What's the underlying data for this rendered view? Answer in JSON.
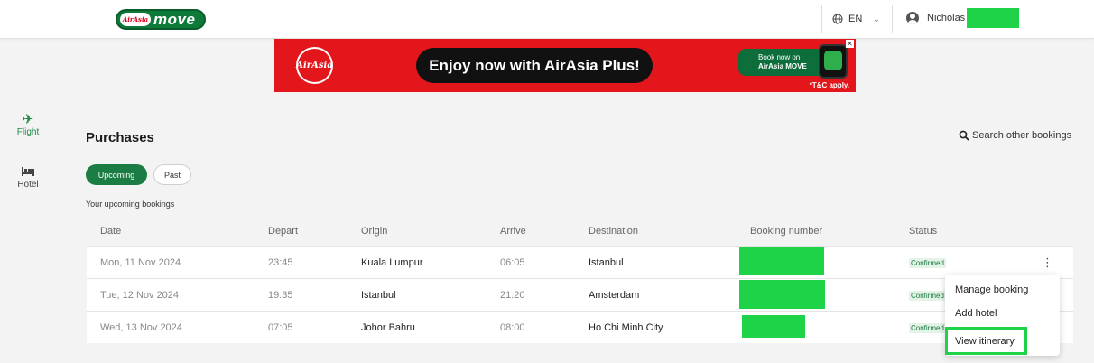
{
  "header": {
    "logo": {
      "badge": "AirAsia",
      "word": "move"
    },
    "language": "EN",
    "user_name": "Nicholas"
  },
  "banner": {
    "brand": "AirAsia",
    "headline": "Enjoy now with AirAsia Plus!",
    "cta_line1": "Book now on",
    "cta_line2": "AirAsia MOVE",
    "close": "✕",
    "tnc": "*T&C apply."
  },
  "nav": [
    {
      "label": "Flight",
      "icon": "plane-icon",
      "glyph": "✈"
    },
    {
      "label": "Hotel",
      "icon": "bed-icon",
      "glyph": "🛏"
    }
  ],
  "page": {
    "title": "Purchases",
    "search_other": "Search other bookings",
    "tabs": [
      "Upcoming",
      "Past"
    ],
    "subtitle": "Your upcoming bookings"
  },
  "table": {
    "headers": [
      "Date",
      "Depart",
      "Origin",
      "Arrive",
      "Destination",
      "Booking number",
      "Status"
    ],
    "rows": [
      {
        "date": "Mon, 11 Nov 2024",
        "depart": "23:45",
        "origin": "Kuala Lumpur",
        "arrive": "06:05",
        "destination": "Istanbul",
        "status": "Confirmed"
      },
      {
        "date": "Tue, 12 Nov 2024",
        "depart": "19:35",
        "origin": "Istanbul",
        "arrive": "21:20",
        "destination": "Amsterdam",
        "status": "Confirmed"
      },
      {
        "date": "Wed, 13 Nov 2024",
        "depart": "07:05",
        "origin": "Johor Bahru",
        "arrive": "08:00",
        "destination": "Ho Chi Minh City",
        "status": "Confirmed"
      }
    ]
  },
  "menu": [
    "Manage booking",
    "Add hotel",
    "View itinerary"
  ],
  "colors": {
    "brand_green": "#1b7d43",
    "banner_red": "#e3161b",
    "redaction": "#1ed348"
  }
}
